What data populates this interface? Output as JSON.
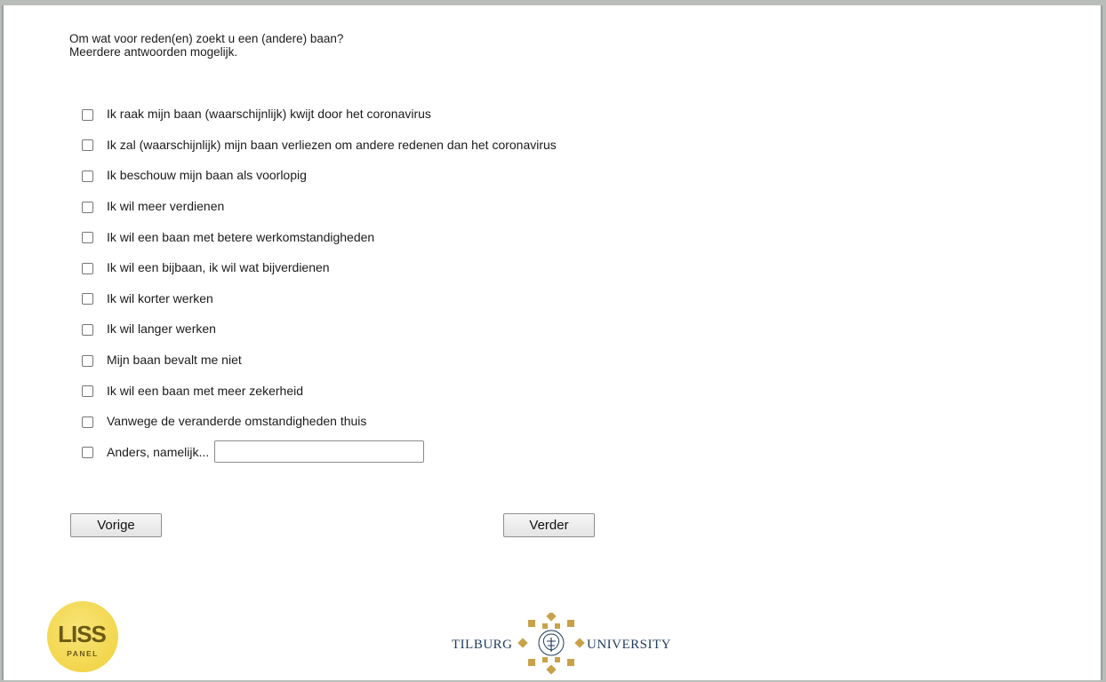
{
  "question": {
    "line1": "Om wat voor reden(en) zoekt u een (andere) baan?",
    "line2": "Meerdere antwoorden mogelijk."
  },
  "options": [
    {
      "label": "Ik raak mijn baan (waarschijnlijk) kwijt door het coronavirus",
      "checked": false
    },
    {
      "label": "Ik zal (waarschijnlijk) mijn baan verliezen om andere redenen dan het coronavirus",
      "checked": false
    },
    {
      "label": "Ik beschouw mijn baan als voorlopig",
      "checked": false
    },
    {
      "label": "Ik wil meer verdienen",
      "checked": false
    },
    {
      "label": "Ik wil een baan met betere werkomstandigheden",
      "checked": false
    },
    {
      "label": "Ik wil een bijbaan, ik wil wat bijverdienen",
      "checked": false
    },
    {
      "label": "Ik wil korter werken",
      "checked": false
    },
    {
      "label": "Ik wil langer werken",
      "checked": false
    },
    {
      "label": "Mijn baan bevalt me niet",
      "checked": false
    },
    {
      "label": "Ik wil een baan met meer zekerheid",
      "checked": false
    },
    {
      "label": "Vanwege de veranderde omstandigheden thuis",
      "checked": false
    },
    {
      "label": "Anders, namelijk...",
      "checked": false,
      "other_value": ""
    }
  ],
  "buttons": {
    "previous": "Vorige",
    "next": "Verder"
  },
  "logos": {
    "liss": {
      "top": "LISS",
      "bottom": "PANEL"
    },
    "tilburg": {
      "left": "TILBURG",
      "right": "UNIVERSITY"
    }
  },
  "colors": {
    "liss_yellow": "#f2d54a",
    "liss_text": "#6b5a14",
    "tilburg_gold": "#c8a14a",
    "tilburg_blue": "#1f3a5c"
  }
}
